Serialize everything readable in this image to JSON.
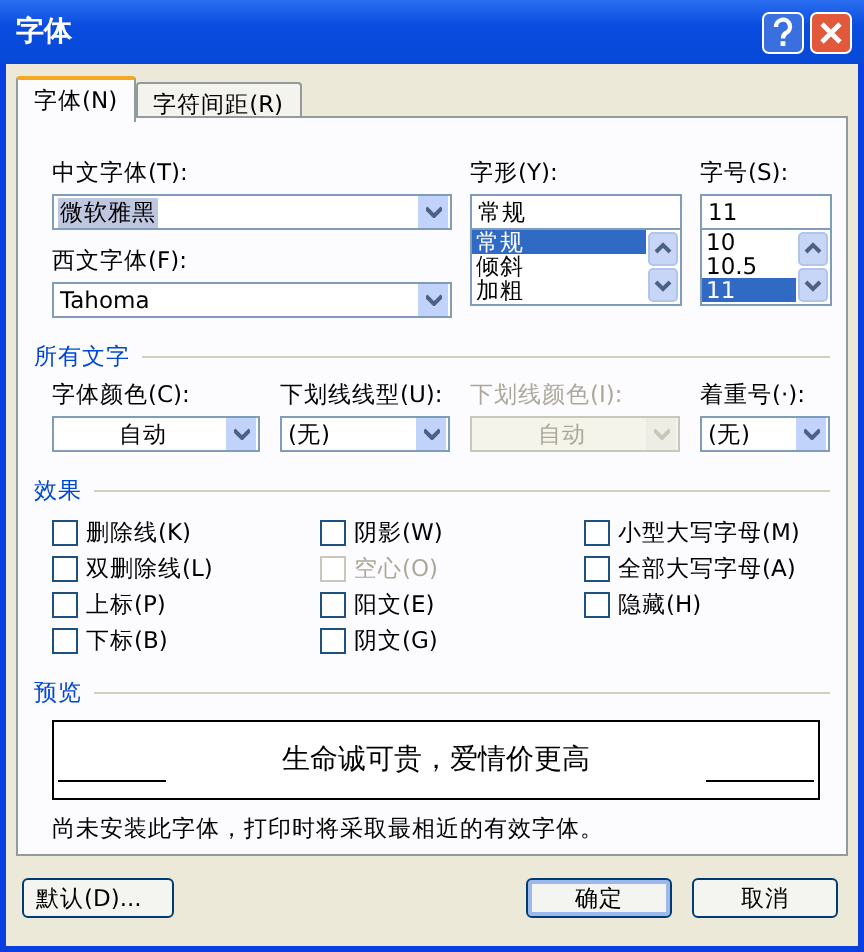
{
  "window": {
    "title": "字体"
  },
  "tabs": [
    {
      "label": "字体(N)",
      "selected": true
    },
    {
      "label": "字符间距(R)",
      "selected": false
    }
  ],
  "font_fields": {
    "chinese_font": {
      "label": "中文字体(T):",
      "value": "微软雅黑"
    },
    "western_font": {
      "label": "西文字体(F):",
      "value": "Tahoma"
    },
    "style": {
      "label": "字形(Y):",
      "value": "常规",
      "options": [
        {
          "label": "常规",
          "selected": true
        },
        {
          "label": "倾斜",
          "selected": false
        },
        {
          "label": "加粗",
          "selected": false
        }
      ]
    },
    "size": {
      "label": "字号(S):",
      "value": "11",
      "options": [
        {
          "label": "10",
          "selected": false
        },
        {
          "label": "10.5",
          "selected": false
        },
        {
          "label": "11",
          "selected": true
        }
      ]
    }
  },
  "all_text": {
    "title": "所有文字",
    "dropdowns": [
      {
        "label": "字体颜色(C):",
        "value": "自动",
        "disabled": false,
        "centered": true
      },
      {
        "label": "下划线线型(U):",
        "value": "(无)",
        "disabled": false,
        "centered": false
      },
      {
        "label": "下划线颜色(I):",
        "value": "自动",
        "disabled": true,
        "centered": true
      },
      {
        "label": "着重号(·):",
        "value": "(无)",
        "disabled": false,
        "centered": false
      }
    ]
  },
  "effects": {
    "title": "效果",
    "columns": [
      [
        {
          "label": "删除线(K)",
          "checked": false,
          "disabled": false
        },
        {
          "label": "双删除线(L)",
          "checked": false,
          "disabled": false
        },
        {
          "label": "上标(P)",
          "checked": false,
          "disabled": false
        },
        {
          "label": "下标(B)",
          "checked": false,
          "disabled": false
        }
      ],
      [
        {
          "label": "阴影(W)",
          "checked": false,
          "disabled": false
        },
        {
          "label": "空心(O)",
          "checked": false,
          "disabled": true
        },
        {
          "label": "阳文(E)",
          "checked": false,
          "disabled": false
        },
        {
          "label": "阴文(G)",
          "checked": false,
          "disabled": false
        }
      ],
      [
        {
          "label": "小型大写字母(M)",
          "checked": false,
          "disabled": false
        },
        {
          "label": "全部大写字母(A)",
          "checked": false,
          "disabled": false
        },
        {
          "label": "隐藏(H)",
          "checked": false,
          "disabled": false
        }
      ]
    ]
  },
  "preview": {
    "title": "预览",
    "text": "生命诚可贵，爱情价更高",
    "note": "尚未安装此字体，打印时将采取最相近的有效字体。"
  },
  "buttons": [
    {
      "label": "默认(D)...",
      "primary": false
    },
    {
      "label": "确定",
      "primary": true
    },
    {
      "label": "取消",
      "primary": false
    }
  ]
}
